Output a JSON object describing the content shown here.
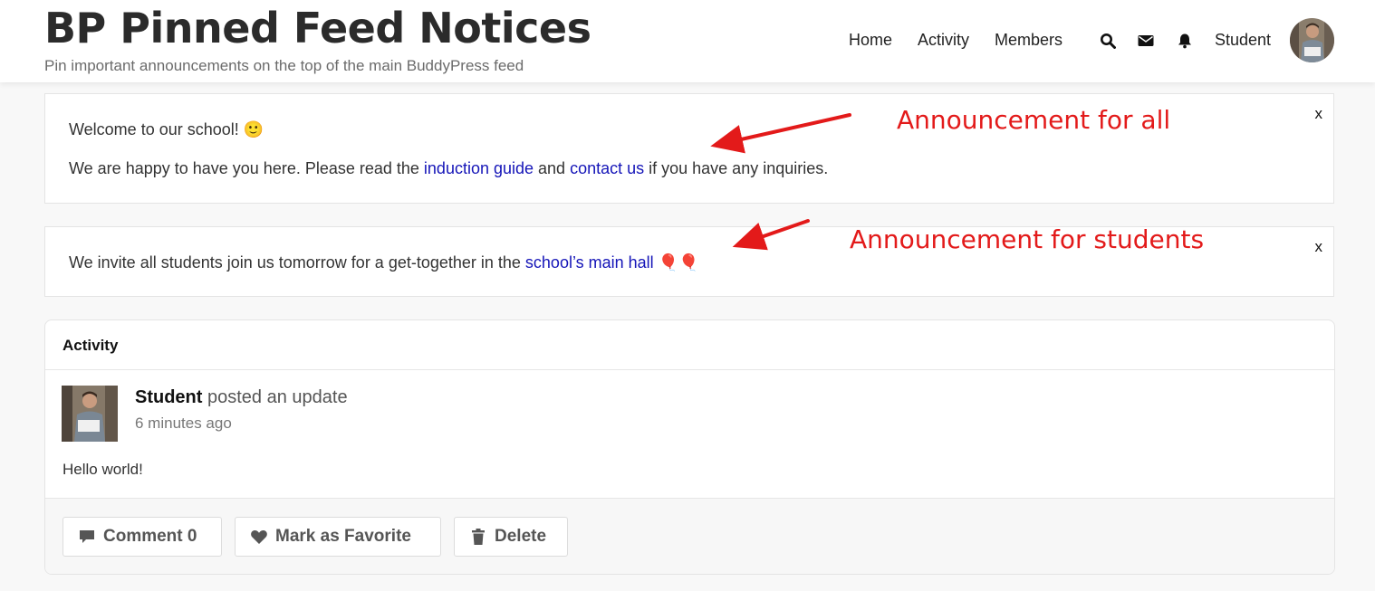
{
  "site": {
    "title": "BP Pinned Feed Notices",
    "description": "Pin important announcements on the top of the main BuddyPress feed"
  },
  "nav": {
    "items": [
      "Home",
      "Activity",
      "Members"
    ],
    "user_name": "Student",
    "icons": [
      "search-icon",
      "envelope-icon",
      "bell-icon"
    ]
  },
  "notices": [
    {
      "greeting": "Welcome to our school! 🙂",
      "text_before": "We are happy to have you here. Please read the ",
      "link1": "induction guide",
      "text_mid": " and ",
      "link2": "contact us",
      "text_after": " if you have any inquiries.",
      "close": "x",
      "callout": "Announcement for all"
    },
    {
      "text_before": "We invite all students join us tomorrow for a get-together in the ",
      "link1": "school’s main hall",
      "text_after": " 🎈🎈",
      "close": "x",
      "callout": "Announcement for students"
    }
  ],
  "activity": {
    "heading": "Activity",
    "author": "Student",
    "action": " posted an update",
    "time": "6 minutes ago",
    "content": "Hello world!",
    "buttons": {
      "comment": "Comment 0",
      "favorite": "Mark as Favorite",
      "delete": "Delete"
    }
  },
  "colors": {
    "link": "#1515b8",
    "callout": "#e31a1a"
  }
}
